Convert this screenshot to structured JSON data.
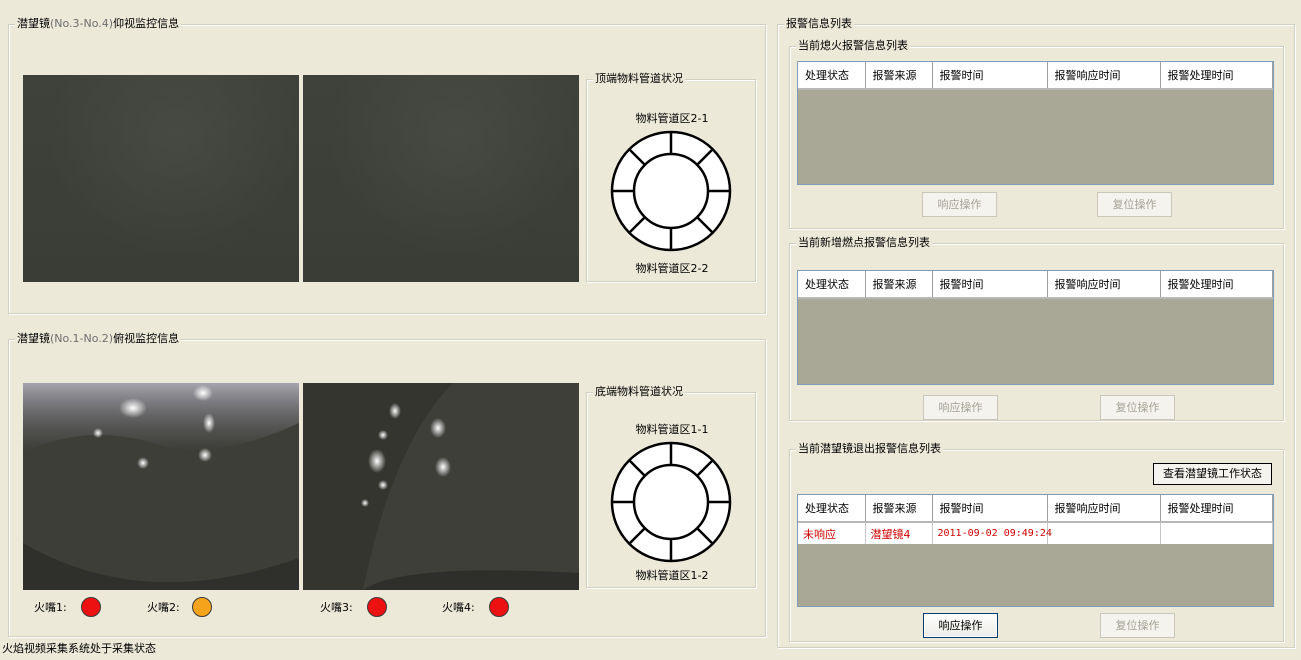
{
  "top_panel": {
    "title_prefix": "潜望镜",
    "title_highlight": "(No.3-No.4)",
    "title_suffix": "仰视监控信息",
    "pipe_group_title": "顶端物料管道状况",
    "pipe_label_top": "物料管道区2-1",
    "pipe_label_bottom": "物料管道区2-2"
  },
  "bottom_panel": {
    "title_prefix": "潜望镜",
    "title_highlight": "(No.1-No.2)",
    "title_suffix": "俯视监控信息",
    "pipe_group_title": "底端物料管道状况",
    "pipe_label_top": "物料管道区1-1",
    "pipe_label_bottom": "物料管道区1-2",
    "nozzles": [
      {
        "label": "火嘴1:",
        "color": "#EE1111"
      },
      {
        "label": "火嘴2:",
        "color": "#F5A31A"
      },
      {
        "label": "火嘴3:",
        "color": "#EE1111"
      },
      {
        "label": "火嘴4:",
        "color": "#EE1111"
      }
    ]
  },
  "status_bar": "火焰视频采集系统处于采集状态",
  "alarm_panel": {
    "title": "报警信息列表",
    "columns": [
      "处理状态",
      "报警来源",
      "报警时间",
      "报警响应时间",
      "报警处理时间"
    ],
    "flameout": {
      "title": "当前熄火报警信息列表",
      "respond_label": "响应操作",
      "reset_label": "复位操作"
    },
    "new_fire": {
      "title": "当前新增燃点报警信息列表",
      "respond_label": "响应操作",
      "reset_label": "复位操作"
    },
    "periscope_exit": {
      "title": "当前潜望镜退出报警信息列表",
      "view_status_label": "查看潜望镜工作状态",
      "respond_label": "响应操作",
      "reset_label": "复位操作",
      "rows": [
        {
          "status": "未响应",
          "source": "潜望镜4",
          "time": "2011-09-02 09:49:24",
          "response_time": "",
          "handle_time": ""
        }
      ]
    }
  }
}
